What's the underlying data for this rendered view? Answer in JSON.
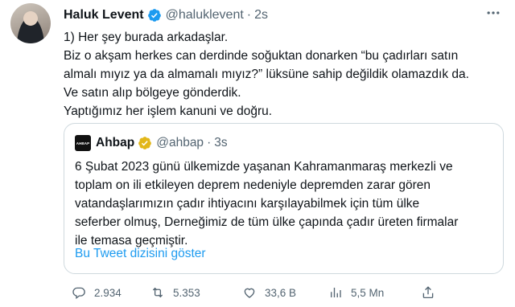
{
  "tweet": {
    "author_name": "Haluk Levent",
    "handle": "@haluklevent",
    "separator": "·",
    "time": "2s",
    "more_icon": "more-horizontal-icon",
    "lines": [
      "1) Her şey burada arkadaşlar.",
      "Biz o akşam herkes can derdinde soğuktan donarken “bu çadırları satın",
      "almalı mıyız ya da almamalı mıyız?” lüksüne sahip değildik olamazdık da.",
      "Ve satın alıp bölgeye gönderdik.",
      "Yaptığımız her işlem kanuni ve doğru."
    ]
  },
  "quote": {
    "logo_text": "AHBAP",
    "author_name": "Ahbap",
    "handle": "@ahbap",
    "separator": "·",
    "time": "3s",
    "lines": [
      "6 Şubat 2023 günü ülkemizde yaşanan Kahramanmaraş merkezli ve",
      "toplam on ili etkileyen deprem nedeniyle depremden zarar gören",
      "vatandaşlarımızın çadır ihtiyacını karşılayabilmek için tüm ülke",
      "seferber olmuş, Derneğimiz de tüm ülke çapında çadır üreten firmalar",
      "ile temasa geçmiştir."
    ],
    "thread_link": "Bu Tweet dizisini göster"
  },
  "actions": {
    "replies": "2.934",
    "retweets": "5.353",
    "likes": "33,6 B",
    "views": "5,5 Mn"
  },
  "colors": {
    "verified_blue": "#1d9bf0",
    "gold_badge": "#e2b719",
    "muted": "#536471",
    "link": "#1d9bf0"
  }
}
